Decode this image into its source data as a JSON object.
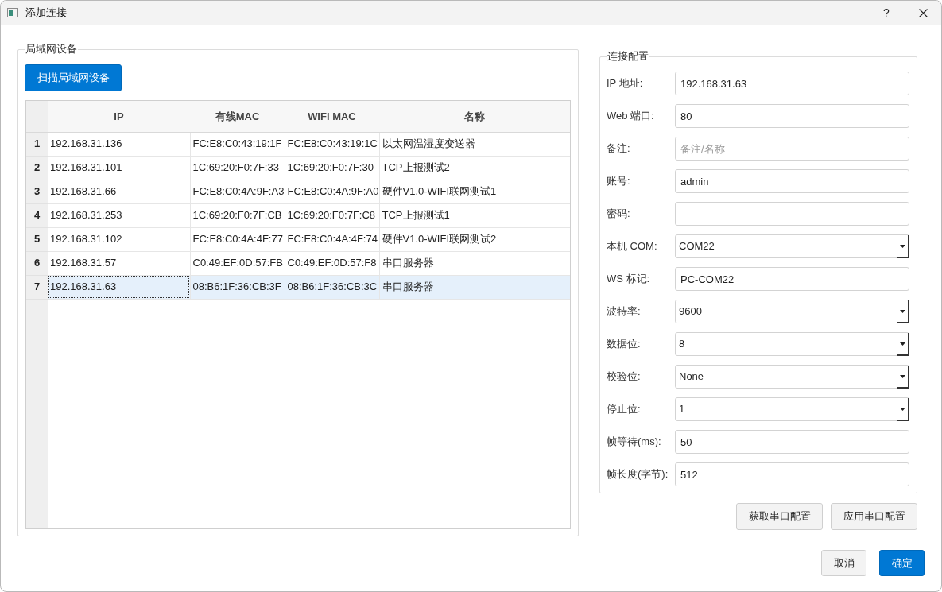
{
  "window": {
    "title": "添加连接",
    "help_button": "?"
  },
  "lan_devices": {
    "title": "局域网设备",
    "scan_button": "扫描局域网设备",
    "table": {
      "columns": [
        "IP",
        "有线MAC",
        "WiFi MAC",
        "名称"
      ],
      "rows": [
        {
          "number": "1",
          "cells": [
            "192.168.31.136",
            "FC:E8:C0:43:19:1F",
            "FC:E8:C0:43:19:1C",
            "以太网温湿度变送器"
          ],
          "selected": false
        },
        {
          "number": "2",
          "cells": [
            "192.168.31.101",
            "1C:69:20:F0:7F:33",
            "1C:69:20:F0:7F:30",
            "TCP上报测试2"
          ],
          "selected": false
        },
        {
          "number": "3",
          "cells": [
            "192.168.31.66",
            "FC:E8:C0:4A:9F:A3",
            "FC:E8:C0:4A:9F:A0",
            "硬件V1.0-WIFI联网测试1"
          ],
          "selected": false
        },
        {
          "number": "4",
          "cells": [
            "192.168.31.253",
            "1C:69:20:F0:7F:CB",
            "1C:69:20:F0:7F:C8",
            "TCP上报测试1"
          ],
          "selected": false
        },
        {
          "number": "5",
          "cells": [
            "192.168.31.102",
            "FC:E8:C0:4A:4F:77",
            "FC:E8:C0:4A:4F:74",
            "硬件V1.0-WIFI联网测试2"
          ],
          "selected": false
        },
        {
          "number": "6",
          "cells": [
            "192.168.31.57",
            "C0:49:EF:0D:57:FB",
            "C0:49:EF:0D:57:F8",
            "串口服务器"
          ],
          "selected": false
        },
        {
          "number": "7",
          "cells": [
            "192.168.31.63",
            "08:B6:1F:36:CB:3F",
            "08:B6:1F:36:CB:3C",
            "串口服务器"
          ],
          "selected": true
        }
      ]
    }
  },
  "connection_config": {
    "title": "连接配置",
    "fields": [
      {
        "label": "IP 地址:",
        "kind": "text",
        "value": "192.168.31.63"
      },
      {
        "label": "Web 端口:",
        "kind": "text",
        "value": "80"
      },
      {
        "label": "备注:",
        "kind": "text",
        "placeholder": "备注/名称"
      },
      {
        "label": "账号:",
        "kind": "text",
        "value": "admin"
      },
      {
        "label": "密码:",
        "kind": "password"
      },
      {
        "label": "本机 COM:",
        "kind": "select",
        "value": "COM22"
      },
      {
        "label": "WS 标记:",
        "kind": "text",
        "value": "PC-COM22"
      },
      {
        "label": "波特率:",
        "kind": "select",
        "value": "9600"
      },
      {
        "label": "数据位:",
        "kind": "select",
        "value": "8"
      },
      {
        "label": "校验位:",
        "kind": "select",
        "value": "None"
      },
      {
        "label": "停止位:",
        "kind": "select",
        "value": "1"
      },
      {
        "label": "帧等待(ms):",
        "kind": "text",
        "value": "50"
      },
      {
        "label": "帧长度(字节):",
        "kind": "text",
        "value": "512"
      }
    ],
    "serial_buttons": [
      "获取串口配置",
      "应用串口配置"
    ]
  },
  "dialog_buttons": [
    {
      "label": "取消",
      "kind": "secondary"
    },
    {
      "label": "确定",
      "kind": "primary"
    }
  ]
}
